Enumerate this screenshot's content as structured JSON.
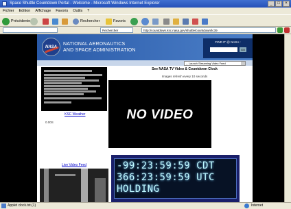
{
  "window": {
    "title": "Space Shuttle Countdown Portal - Welcome - Microsoft Windows Internet Explorer",
    "controls": [
      "_",
      "□",
      "×"
    ]
  },
  "menu": [
    "Fichier",
    "Edition",
    "Affichage",
    "Favoris",
    "Outils",
    "?"
  ],
  "toolbar": {
    "back_label": "Précédente",
    "search_label": "Rechercher",
    "favorites_label": "Favoris"
  },
  "address": {
    "search_value": "Rechercher",
    "url": "http://countdown.ksc.nasa.gov/shuttle/countdown/lc39"
  },
  "banner": {
    "logo_text": "NASA",
    "agency_line1": "NATIONAL AERONAUTICS",
    "agency_line2": "AND SPACE ADMINISTRATION",
    "find_label": "FIND IT @ NASA :",
    "go_label": "GO"
  },
  "dropdown": {
    "selected": "-- Launch Streaming Video Feed"
  },
  "left": {
    "weather_link": "KSC Weather",
    "weather_note": "0.00S",
    "video_link": "Live Video Feed"
  },
  "main": {
    "heading": "See NASA TV Video & Countdown Clock",
    "subheading": "Images refresh every 10 seconds",
    "no_video_text": "NO VIDEO"
  },
  "clock": {
    "line1": "-99:23:59:59 CDT",
    "line2": "366:23:59:59 UTC",
    "line3": "HOLDING"
  },
  "status": {
    "left": "Applet clock.txt.(1)",
    "right": "Internet"
  }
}
